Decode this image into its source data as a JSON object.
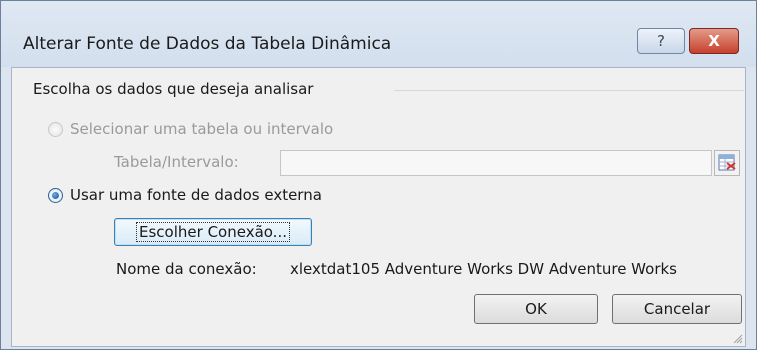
{
  "window": {
    "title": "Alterar Fonte de Dados da Tabela Dinâmica",
    "help_label": "?",
    "close_label": "X"
  },
  "group": {
    "label": "Escolha os dados que deseja analisar"
  },
  "option_range": {
    "label": "Selecionar uma tabela ou intervalo",
    "checked": false,
    "enabled": false,
    "field_label": "Tabela/Intervalo:",
    "field_value": ""
  },
  "option_external": {
    "label": "Usar uma fonte de dados externa",
    "checked": true,
    "choose_button": "Escolher Conexão...",
    "connection_label": "Nome da conexão:",
    "connection_value": "xlextdat105 Adventure Works DW Adventure Works"
  },
  "buttons": {
    "ok": "OK",
    "cancel": "Cancelar"
  },
  "icons": {
    "help": "help-icon",
    "close": "close-icon",
    "range_picker": "range-picker-icon",
    "resize": "resize-grip-icon"
  },
  "colors": {
    "title_bar": "#d3dfee",
    "dialog_bg": "#f0f0f0",
    "close_button": "#c5412c",
    "radio_selected": "#184f8f"
  }
}
